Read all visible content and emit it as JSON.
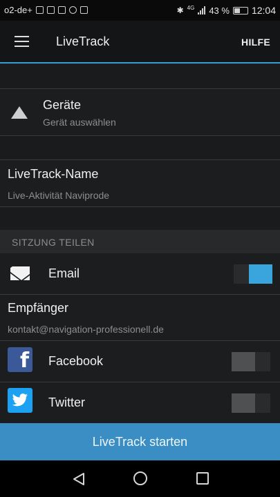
{
  "status_bar": {
    "carrier": "o2-de+",
    "network": "4G",
    "battery": "43 %",
    "battery_level": 0.43,
    "time": "12:04"
  },
  "app_bar": {
    "title": "LiveTrack",
    "help_label": "HILFE"
  },
  "devices": {
    "title": "Geräte",
    "subtitle": "Gerät auswählen",
    "icon": "warning-triangle-icon"
  },
  "livetrack_name": {
    "label": "LiveTrack-Name",
    "value": "Live-Aktivität Naviprode"
  },
  "share_session": {
    "header": "SITZUNG TEILEN",
    "email": {
      "label": "Email",
      "icon": "mail-icon",
      "enabled": true
    },
    "recipient": {
      "label": "Empfänger",
      "value": "kontakt@navigation-professionell.de"
    },
    "facebook": {
      "label": "Facebook",
      "icon": "facebook-icon",
      "enabled": false
    },
    "twitter": {
      "label": "Twitter",
      "icon": "twitter-icon",
      "enabled": false
    }
  },
  "start_button": {
    "label": "LiveTrack starten"
  },
  "colors": {
    "accent": "#3b9bd6",
    "toggle_on": "#3aa5dd",
    "button": "#3b8ec4",
    "facebook": "#3b5998",
    "twitter": "#1da1f2"
  }
}
